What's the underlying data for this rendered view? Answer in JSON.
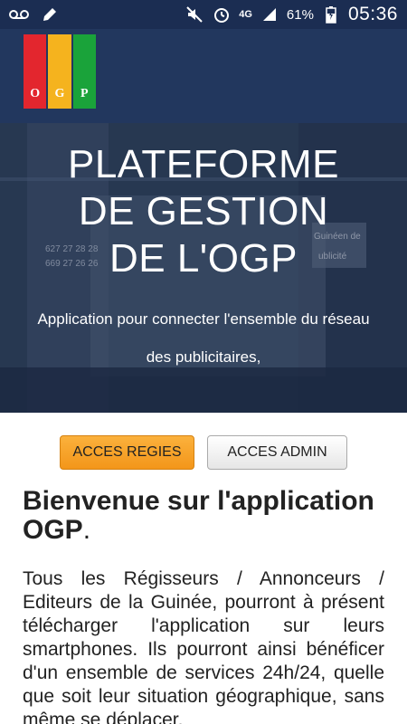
{
  "status_bar": {
    "left_icons": [
      "voicemail-icon",
      "pencil-icon"
    ],
    "right_icons": [
      "mute-icon",
      "alarm-icon",
      "signal-icon",
      "battery-charging-icon"
    ],
    "network": "4G",
    "battery": "61%",
    "time": "05:36",
    "colors": {
      "background": "#1b2d52"
    }
  },
  "app_bar": {
    "logo": {
      "letters": [
        "O",
        "G",
        "P"
      ],
      "colors": [
        "#e3262e",
        "#f5b31e",
        "#1aa33a"
      ]
    },
    "background": "#22375e"
  },
  "hero": {
    "title_lines": [
      "PLATEFORME",
      "DE GESTION",
      "DE L'OGP"
    ],
    "subtitle_lines": [
      "Application pour connecter l'ensemble du réseau",
      "des publicitaires,"
    ],
    "bg_sign_lines": [
      "627 27 28 28",
      "669 27 26 26",
      "Guinéen de",
      "ublicité"
    ]
  },
  "buttons": {
    "regies_label": "ACCES REGIES",
    "admin_label": "ACCES ADMIN"
  },
  "content": {
    "welcome_heading": "Bienvenue sur l'application OGP",
    "welcome_period": ".",
    "body": "Tous les Régisseurs / Annonceurs / Editeurs de la Guinée, pourront à présent télécharger l'application sur leurs smartphones. Ils pourront ainsi bénéficer d'un ensemble de services 24h/24, quelle que soit leur situation géographique, sans même se déplacer."
  }
}
